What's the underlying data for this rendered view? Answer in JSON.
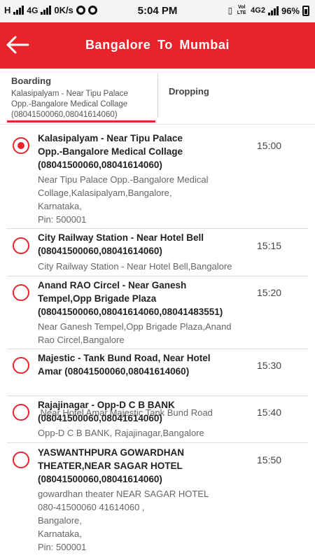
{
  "status_bar": {
    "left_signal": "H",
    "network": "4G",
    "speed": "0K/s",
    "time": "5:04 PM",
    "volte": "Vol LTE",
    "network2": "4G2",
    "battery": "96%"
  },
  "toolbar": {
    "title": "Bangalore  To  Mumbai",
    "accent": "#e8232b"
  },
  "tabs": {
    "boarding_label": "Boarding",
    "boarding_sub_1": "Kalasipalyam - Near Tipu Palace",
    "boarding_sub_2": "Opp.-Bangalore Medical Collage",
    "boarding_sub_3": "(08041500060,08041614060)",
    "dropping_label": "Dropping"
  },
  "points": [
    {
      "selected": true,
      "time": "15:00",
      "name": [
        "Kalasipalyam - Near Tipu Palace",
        "Opp.-Bangalore Medical Collage",
        "(08041500060,08041614060)"
      ],
      "address": [
        "Near Tipu Palace Opp.-Bangalore Medical",
        "Collage,Kalasipalyam,Bangalore,",
        "Karnataka,",
        "Pin: 500001"
      ]
    },
    {
      "selected": false,
      "time": "15:15",
      "name": [
        "City Railway Station - Near Hotel Bell",
        "(08041500060,08041614060)"
      ],
      "address": [
        "City Railway Station - Near Hotel Bell,Bangalore"
      ]
    },
    {
      "selected": false,
      "time": "15:20",
      "name": [
        "Anand RAO Circel - Near Ganesh",
        "Tempel,Opp Brigade Plaza",
        "(08041500060,08041614060,08041483551)"
      ],
      "address": [
        "Near Ganesh Tempel,Opp Brigade Plaza,Anand",
        "Rao Circel,Bangalore"
      ]
    },
    {
      "selected": false,
      "time": "15:30",
      "name": [
        "Majestic - Tank  Bund Road, Near Hotel",
        "Amar (08041500060,08041614060)"
      ],
      "address": [
        " Near Hotel Amar,Majestic Tank Bund Road"
      ]
    },
    {
      "selected": false,
      "time": "15:40",
      "name": [
        "Rajajinagar - Opp-D C B BANK",
        "(08041500060,08041614060)"
      ],
      "address": [
        "Opp-D C B BANK, Rajajinagar,Bangalore"
      ]
    },
    {
      "selected": false,
      "time": "15:50",
      "name": [
        "YASWANTHPURA GOWARDHAN",
        "THEATER,NEAR SAGAR HOTEL",
        "(08041500060,08041614060)"
      ],
      "address": [
        "gowardhan theater NEAR SAGAR HOTEL",
        "080-41500060 41614060 ,",
        "Bangalore,",
        "Karnataka,",
        "Pin: 500001"
      ]
    }
  ]
}
